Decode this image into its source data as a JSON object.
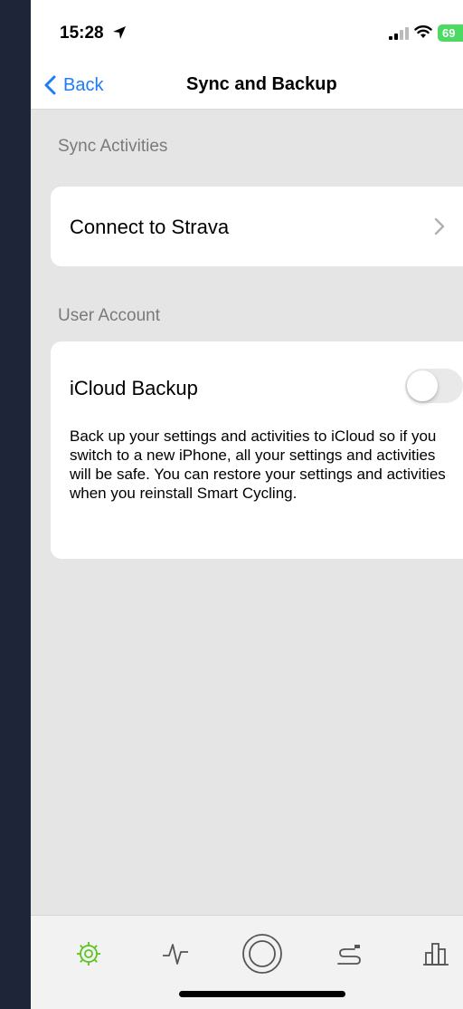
{
  "status_bar": {
    "time": "15:28",
    "battery": "69"
  },
  "nav": {
    "back_label": "Back",
    "title": "Sync and Backup"
  },
  "sections": {
    "sync": {
      "header": "Sync Activities",
      "row_label": "Connect to Strava"
    },
    "account": {
      "header": "User Account",
      "row_label": "iCloud Backup",
      "toggle_on": false,
      "description": "Back up your settings and activities to iCloud so if you switch to a new iPhone, all your settings and activities will be safe. You can restore your settings and activities  when you reinstall Smart Cycling."
    }
  },
  "tabs": [
    {
      "icon": "gear-icon",
      "selected": true
    },
    {
      "icon": "activity-icon",
      "selected": false
    },
    {
      "icon": "ride-target-icon",
      "selected": false
    },
    {
      "icon": "route-icon",
      "selected": false
    },
    {
      "icon": "stats-bars-icon",
      "selected": false
    }
  ],
  "colors": {
    "accent": "#1f7cf4",
    "tab_selected": "#5cc41f",
    "tab_unselected": "#555555"
  }
}
